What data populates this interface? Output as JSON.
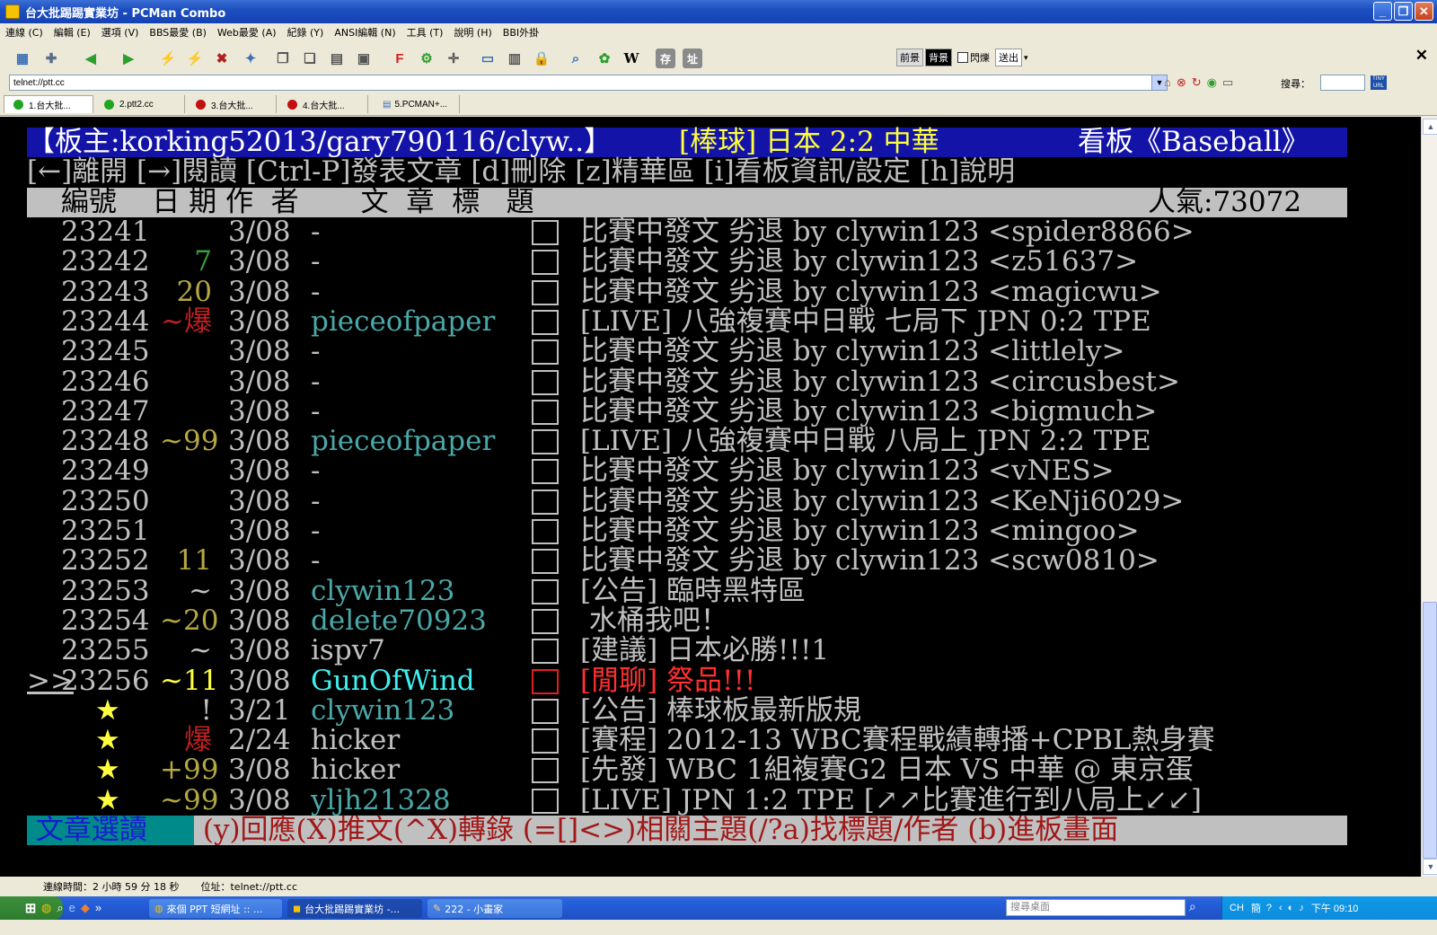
{
  "window": {
    "title": "台大批踢踢實業坊 - PCMan Combo"
  },
  "menu": [
    "連線 (C)",
    "編輯 (E)",
    "選項 (V)",
    "BBS最愛 (B)",
    "Web最愛 (A)",
    "紀錄 (Y)",
    "ANSI編輯 (N)",
    "工具 (T)",
    "說明 (H)",
    "BBI外掛"
  ],
  "toolbar_right": {
    "fg": "前景",
    "bg": "背景",
    "blink": "閃爍",
    "send": "送出"
  },
  "address": {
    "value": "telnet://ptt.cc"
  },
  "search_label": "搜尋：",
  "tabs": [
    {
      "label": "1.台大批...",
      "color": "#1fa51f"
    },
    {
      "label": "2.ptt2.cc",
      "color": "#1fa51f"
    },
    {
      "label": "3.台大批...",
      "color": "#c01010"
    },
    {
      "label": "4.台大批...",
      "color": "#c01010"
    },
    {
      "label": "5.PCMAN+...",
      "color": ""
    }
  ],
  "terminal": {
    "header": {
      "moderators": "【板主:korking52013/gary790116/clyw..】",
      "topic": "[棒球] 日本 2:2 中華",
      "board": "看板《Baseball》"
    },
    "help_line": "[←]離開 [→]閱讀 [Ctrl-P]發表文章 [d]刪除 [z]精華區 [i]看板資訊/設定 [h]說明",
    "columns": {
      "left": " 編號    日 期 作  者       文  章  標   題",
      "popularity": "人氣:73072"
    },
    "rows": [
      {
        "cursor": "",
        "num": "23241",
        "mark": "",
        "mark_color": "w",
        "date": "3/08",
        "author": "-",
        "author_color": "w",
        "title": "比賽中發文 劣退 by clywin123 <spider8866>",
        "title_color": "w"
      },
      {
        "cursor": "",
        "num": "23242",
        "mark": "7",
        "mark_color": "g",
        "date": "3/08",
        "author": "-",
        "author_color": "w",
        "title": "比賽中發文 劣退 by clywin123 <z51637>",
        "title_color": "w"
      },
      {
        "cursor": "",
        "num": "23243",
        "mark": "20",
        "mark_color": "y",
        "date": "3/08",
        "author": "-",
        "author_color": "w",
        "title": "比賽中發文 劣退 by clywin123 <magicwu>",
        "title_color": "w"
      },
      {
        "cursor": "",
        "num": "23244",
        "mark": "~爆",
        "mark_color": "r",
        "date": "3/08",
        "author": "pieceofpaper",
        "author_color": "c",
        "title": "[LIVE] 八強複賽中日戰 七局下 JPN 0:2 TPE",
        "title_color": "w"
      },
      {
        "cursor": "",
        "num": "23245",
        "mark": "",
        "mark_color": "w",
        "date": "3/08",
        "author": "-",
        "author_color": "w",
        "title": "比賽中發文 劣退 by clywin123 <littlely>",
        "title_color": "w"
      },
      {
        "cursor": "",
        "num": "23246",
        "mark": "",
        "mark_color": "w",
        "date": "3/08",
        "author": "-",
        "author_color": "w",
        "title": "比賽中發文 劣退 by clywin123 <circusbest>",
        "title_color": "w"
      },
      {
        "cursor": "",
        "num": "23247",
        "mark": "",
        "mark_color": "w",
        "date": "3/08",
        "author": "-",
        "author_color": "w",
        "title": "比賽中發文 劣退 by clywin123 <bigmuch>",
        "title_color": "w"
      },
      {
        "cursor": "",
        "num": "23248",
        "mark": "~99",
        "mark_color": "y",
        "date": "3/08",
        "author": "pieceofpaper",
        "author_color": "c",
        "title": "[LIVE] 八強複賽中日戰 八局上 JPN 2:2 TPE",
        "title_color": "w"
      },
      {
        "cursor": "",
        "num": "23249",
        "mark": "",
        "mark_color": "w",
        "date": "3/08",
        "author": "-",
        "author_color": "w",
        "title": "比賽中發文 劣退 by clywin123 <vNES>",
        "title_color": "w"
      },
      {
        "cursor": "",
        "num": "23250",
        "mark": "",
        "mark_color": "w",
        "date": "3/08",
        "author": "-",
        "author_color": "w",
        "title": "比賽中發文 劣退 by clywin123 <KeNji6029>",
        "title_color": "w"
      },
      {
        "cursor": "",
        "num": "23251",
        "mark": "",
        "mark_color": "w",
        "date": "3/08",
        "author": "-",
        "author_color": "w",
        "title": "比賽中發文 劣退 by clywin123 <mingoo>",
        "title_color": "w"
      },
      {
        "cursor": "",
        "num": "23252",
        "mark": "11",
        "mark_color": "y",
        "date": "3/08",
        "author": "-",
        "author_color": "w",
        "title": "比賽中發文 劣退 by clywin123 <scw0810>",
        "title_color": "w"
      },
      {
        "cursor": "",
        "num": "23253",
        "mark": "~",
        "mark_color": "w",
        "date": "3/08",
        "author": "clywin123",
        "author_color": "c",
        "title": "[公告] 臨時黑特區",
        "title_color": "w"
      },
      {
        "cursor": "",
        "num": "23254",
        "mark": "~20",
        "mark_color": "y",
        "date": "3/08",
        "author": "delete70923",
        "author_color": "c",
        "title": " 水桶我吧！",
        "title_color": "w"
      },
      {
        "cursor": "",
        "num": "23255",
        "mark": "~",
        "mark_color": "w",
        "date": "3/08",
        "author": "ispv7",
        "author_color": "w",
        "title": "[建議] 日本必勝!!!1",
        "title_color": "w"
      },
      {
        "cursor": ">>",
        "num": "23256",
        "mark": "~11",
        "mark_color": "by",
        "date": "3/08",
        "author": "GunOfWind",
        "author_color": "bc",
        "title": "[閒聊] 祭品!!!",
        "title_color": "br"
      },
      {
        "cursor": "",
        "num": "★",
        "mark": "!",
        "mark_color": "w",
        "date": "3/21",
        "author": "clywin123",
        "author_color": "c",
        "title": "[公告] 棒球板最新版規",
        "title_color": "w"
      },
      {
        "cursor": "",
        "num": "★",
        "mark": "爆",
        "mark_color": "r",
        "date": "2/24",
        "author": "hicker",
        "author_color": "w",
        "title": "[賽程] 2012-13 WBC賽程戰績轉播+CPBL熱身賽",
        "title_color": "w"
      },
      {
        "cursor": "",
        "num": "★",
        "mark": "+99",
        "mark_color": "y",
        "date": "3/08",
        "author": "hicker",
        "author_color": "w",
        "title": "[先發] WBC 1組複賽G2 日本 VS 中華 @ 東京蛋",
        "title_color": "w"
      },
      {
        "cursor": "",
        "num": "★",
        "mark": "~99",
        "mark_color": "y",
        "date": "3/08",
        "author": "yljh21328",
        "author_color": "c",
        "title": "[LIVE] JPN 1:2 TPE [↗↗比賽進行到八局上↙↙]",
        "title_color": "w"
      }
    ],
    "footer": {
      "mode": " 文章選讀 ",
      "keys": " (y)回應(X)推文(^X)轉錄 (=[]<>)相關主題(/?a)找標題/作者 (b)進板畫面"
    }
  },
  "status": {
    "connect_time": "連線時間：2 小時 59 分 18 秒",
    "address": "位址：telnet://ptt.cc"
  },
  "taskbar": {
    "tasks": [
      "來個 PPT 短網址 :: ...",
      "台大批踢踢實業坊 -...",
      "222 - 小畫家"
    ],
    "search_placeholder": "搜尋桌面",
    "lang": "CH",
    "clock": "下午 09:10"
  }
}
